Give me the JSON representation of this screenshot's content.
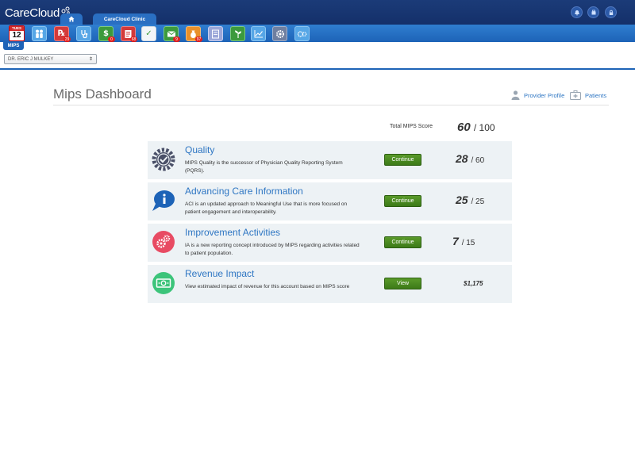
{
  "header": {
    "logo_text": "CareCloud",
    "clinic_tab": "CareCloud Clinic"
  },
  "toolbar": {
    "calendar": {
      "weekday": "TUES",
      "day": "12"
    },
    "badges": {
      "claims": "29",
      "payments": "0",
      "documents": "68",
      "messages": "9",
      "tasks": "97"
    }
  },
  "subnav": {
    "tab": "MIPS"
  },
  "provider": {
    "selected": "DR. ERIC J MULKEY"
  },
  "page": {
    "title": "Mips Dashboard",
    "links": {
      "provider_profile": "Provider Profile",
      "patients": "Patients"
    }
  },
  "summary": {
    "label": "Total MIPS Score",
    "score": "60",
    "max": "100"
  },
  "rows": [
    {
      "title": "Quality",
      "desc": "MIPS Quality is the successor of Physician Quality Reporting System (PQRS).",
      "button": "Continue",
      "score": "28",
      "max": "60"
    },
    {
      "title": "Advancing Care Information",
      "desc": "ACI is an updated approach to Meaningful Use that is more focused on patient engagement and interoperability.",
      "button": "Continue",
      "score": "25",
      "max": "25"
    },
    {
      "title": "Improvement Activities",
      "desc": "IA is a new reporting concept introduced by MIPS regarding activities related to patient population.",
      "button": "Continue",
      "score": "7",
      "max": "15"
    },
    {
      "title": "Revenue Impact",
      "desc": "View estimated impact of revenue for this account based on MIPS score",
      "button": "View",
      "value": "$1,175"
    }
  ],
  "colors": {
    "header_bg": "#14306a",
    "toolbar_bg": "#1d63b7",
    "link": "#2e76c3",
    "row_bg": "#edf2f5",
    "button_green": "#3c7a18",
    "quality_icon": "#4a5068",
    "aci_icon": "#1d63b7",
    "ia_icon": "#e84b63",
    "revenue_icon": "#3cc47a"
  }
}
